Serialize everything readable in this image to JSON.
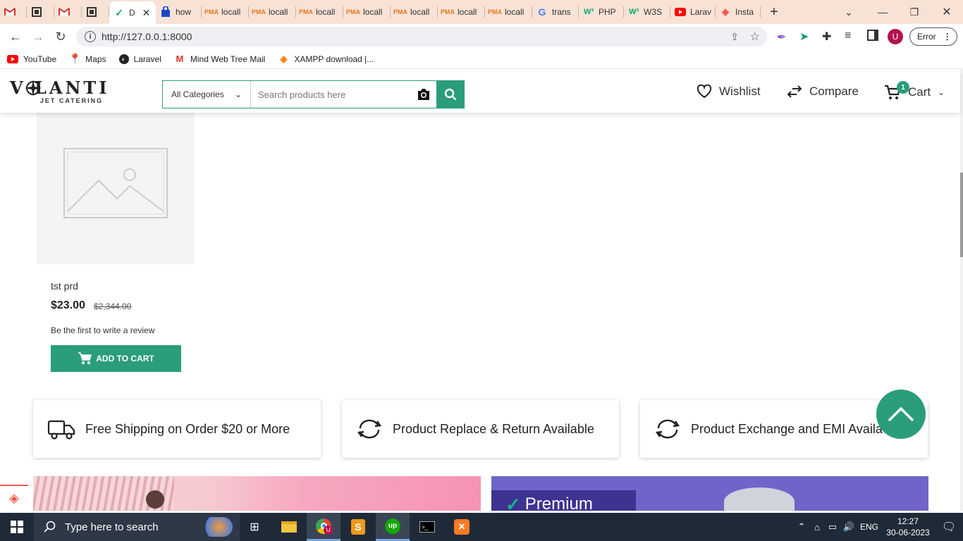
{
  "browser": {
    "tabs": [
      {
        "icon": "gmail-icon",
        "label": ""
      },
      {
        "icon": "book-icon",
        "label": ""
      },
      {
        "icon": "gmail-icon",
        "label": ""
      },
      {
        "icon": "book-icon",
        "label": ""
      },
      {
        "icon": "check-icon",
        "label": "D",
        "active": true
      },
      {
        "icon": "bag-icon",
        "label": "how"
      },
      {
        "icon": "pma-icon",
        "label": "locall"
      },
      {
        "icon": "pma-icon",
        "label": "locall"
      },
      {
        "icon": "pma-icon",
        "label": "locall"
      },
      {
        "icon": "pma-icon",
        "label": "locall"
      },
      {
        "icon": "pma-icon",
        "label": "locall"
      },
      {
        "icon": "pma-icon",
        "label": "locall"
      },
      {
        "icon": "pma-icon",
        "label": "locall"
      },
      {
        "icon": "google-icon",
        "label": "trans"
      },
      {
        "icon": "w3-icon",
        "label": "PHP"
      },
      {
        "icon": "w3-icon",
        "label": "W3S"
      },
      {
        "icon": "youtube-icon",
        "label": "Larav"
      },
      {
        "icon": "laravel-icon",
        "label": "Insta"
      }
    ],
    "url": "http://127.0.0.1:8000",
    "profile_initial": "U",
    "error_label": "Error",
    "bookmarks": [
      {
        "icon": "youtube-icon",
        "label": "YouTube"
      },
      {
        "icon": "maps-icon",
        "label": "Maps"
      },
      {
        "icon": "laravel-icon",
        "label": "Laravel"
      },
      {
        "icon": "gmail-icon",
        "label": "Mind Web Tree Mail"
      },
      {
        "icon": "xampp-icon",
        "label": "XAMPP download |..."
      }
    ]
  },
  "header": {
    "logo_main": "V   LANTI",
    "logo_sub": "JET CATERING",
    "category_select": "All Categories",
    "search_placeholder": "Search products here",
    "wishlist": "Wishlist",
    "compare": "Compare",
    "cart": "Cart",
    "cart_count": "1"
  },
  "product": {
    "name": "tst prd",
    "price": "$23.00",
    "old_price": "$2,344.00",
    "review": "Be the first to write a review",
    "add_to_cart": "ADD TO CART"
  },
  "features": [
    {
      "icon": "truck-icon",
      "label": "Free Shipping on Order $20 or More"
    },
    {
      "icon": "sync-icon",
      "label": "Product Replace & Return Available"
    },
    {
      "icon": "sync-icon",
      "label": "Product Exchange and EMI Availa"
    }
  ],
  "banner_right_text": "Premium",
  "taskbar": {
    "search_placeholder": "Type here to search",
    "language": "ENG",
    "time": "12:27",
    "date": "30-06-2023"
  },
  "colors": {
    "accent": "#2a9d7b",
    "tabstrip": "#f8e2d6",
    "taskbar": "#1f2a38"
  }
}
